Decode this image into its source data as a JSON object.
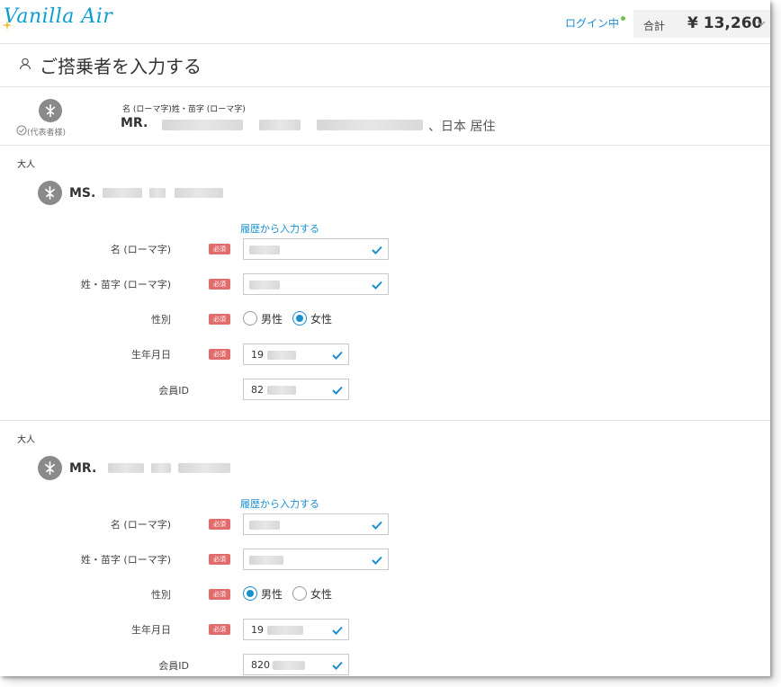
{
  "header": {
    "logo_text": "Vanilla Air",
    "login_status": "ログイン中",
    "total_label": "合計",
    "total_amount": "¥ 13,260"
  },
  "page": {
    "title": "ご搭乗者を入力する"
  },
  "representative": {
    "field_label": "名 (ローマ字)姓・苗字 (ローマ字)",
    "title": "MR.",
    "residence": "、日本 居住",
    "tag": "(代表者様)"
  },
  "passengers": [
    {
      "category": "大人",
      "title": "MS.",
      "history_link": "履歴から入力する",
      "first_name_label": "名 (ローマ字)",
      "last_name_label": "姓・苗字 (ローマ字)",
      "gender_label": "性別",
      "birthdate_label": "生年月日",
      "member_id_label": "会員ID",
      "required_badge": "必須",
      "gender_options": [
        "男性",
        "女性"
      ],
      "gender_selected": "女性",
      "birthdate_value": "19",
      "member_id_value": "82"
    },
    {
      "category": "大人",
      "title": "MR.",
      "history_link": "履歴から入力する",
      "first_name_label": "名 (ローマ字)",
      "last_name_label": "姓・苗字 (ローマ字)",
      "gender_label": "性別",
      "birthdate_label": "生年月日",
      "member_id_label": "会員ID",
      "required_badge": "必須",
      "gender_options": [
        "男性",
        "女性"
      ],
      "gender_selected": "男性",
      "birthdate_value": "19",
      "member_id_value": "820"
    }
  ],
  "colors": {
    "accent": "#1a8fd0",
    "required": "#e26b6b",
    "logo": "#0a9fd0",
    "online": "#6cc24a"
  },
  "icons": [
    "person-icon",
    "plane-avatar-icon",
    "check-icon",
    "chevron-down-icon",
    "circle-check-icon"
  ]
}
